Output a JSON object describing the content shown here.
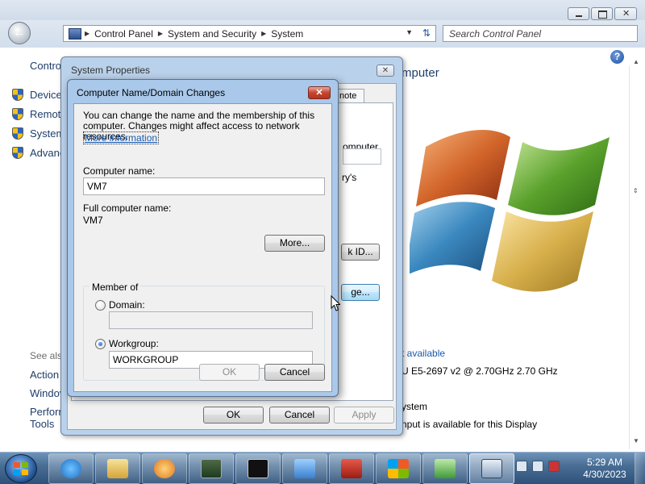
{
  "explorer": {
    "address": [
      "Control Panel",
      "System and Security",
      "System"
    ],
    "search_placeholder": "Search Control Panel",
    "left_pane": {
      "cp_link": "Contro",
      "items": [
        "Device",
        "Remote",
        "System",
        "Advanc"
      ],
      "see_also": "See als",
      "links": [
        "Action",
        "Windov",
        "Perform",
        "Tools"
      ]
    },
    "main": {
      "title": "mputer",
      "rating": "t available",
      "processor": "U E5-2697 v2 @ 2.70GHz   2.70 GHz",
      "system_type": "ystem",
      "pen_touch": "nput is available for this Display"
    }
  },
  "system_properties": {
    "title": "System Properties",
    "tab_remote": "note",
    "bg_text": {
      "computer": "omputer",
      "registry": "ry's",
      "network_id": "k ID...",
      "change": "ge..."
    },
    "buttons": {
      "ok": "OK",
      "cancel": "Cancel",
      "apply": "Apply"
    }
  },
  "domain_changes": {
    "title": "Computer Name/Domain Changes",
    "description": "You can change the name and the membership of this computer. Changes might affect access to network resources.",
    "more_information": "More information",
    "computer_name_label": "Computer name:",
    "computer_name_value": "VM7",
    "full_name_label": "Full computer name:",
    "full_name_value": "VM7",
    "more_button": "More...",
    "member_of": "Member of",
    "domain_label": "Domain:",
    "domain_value": "",
    "workgroup_label": "Workgroup:",
    "workgroup_value": "WORKGROUP",
    "selected_membership": "workgroup",
    "ok": "OK",
    "cancel": "Cancel"
  },
  "taskbar": {
    "time": "5:29 AM",
    "date": "4/30/2023",
    "apps": [
      "internet-explorer",
      "file-explorer",
      "media-player",
      "task-manager",
      "command-prompt",
      "control-panel",
      "toolbox",
      "windows-flag",
      "network-share",
      "system-properties"
    ]
  },
  "colors": {
    "link": "#1a5aae",
    "dialog_frame": "#a9c8ea",
    "taskbar": "#4a6f96"
  }
}
